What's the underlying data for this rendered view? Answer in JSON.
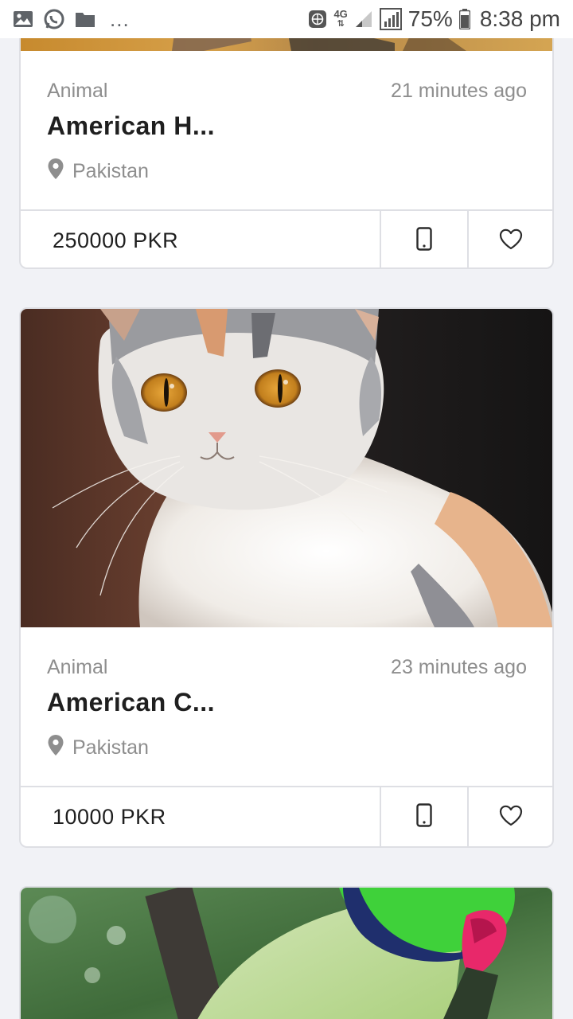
{
  "status_bar": {
    "overflow_dots": "...",
    "network": "4G",
    "battery_pct": "75%",
    "time": "8:38 pm"
  },
  "listings": [
    {
      "category": "Animal",
      "time_ago": "21 minutes ago",
      "title": "American H...",
      "location": "Pakistan",
      "price": "250000 PKR",
      "image": "dog-photo"
    },
    {
      "category": "Animal",
      "time_ago": "23 minutes ago",
      "title": "American C...",
      "location": "Pakistan",
      "price": "10000 PKR",
      "image": "cat-photo"
    },
    {
      "image": "parrot-photo"
    }
  ],
  "icons": {
    "location": "location-pin-icon",
    "phone": "phone-icon",
    "favorite": "heart-icon"
  },
  "colors": {
    "background": "#f1f2f6",
    "card_border": "#dedfe4",
    "muted_text": "#8e8e8e",
    "title_text": "#1f1f1f"
  }
}
